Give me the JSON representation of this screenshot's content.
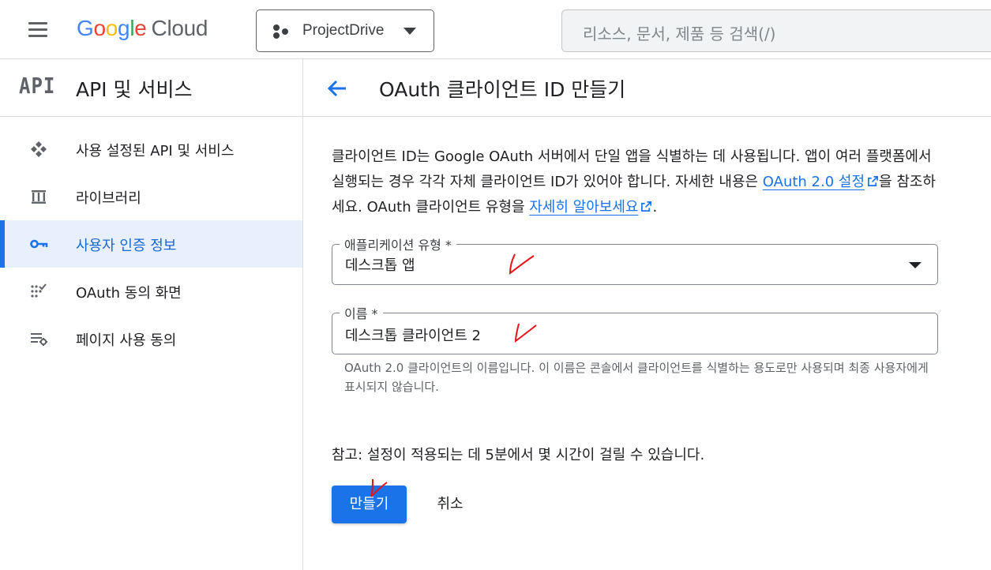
{
  "header": {
    "logo_google": "Google",
    "logo_cloud": "Cloud",
    "project_name": "ProjectDrive",
    "search_placeholder": "리소스, 문서, 제품 등 검색(/)"
  },
  "sidebar": {
    "title": "API 및 서비스",
    "api_icon_text": "API",
    "items": [
      {
        "label": "사용 설정된 API 및 서비스",
        "icon": "api-services-icon"
      },
      {
        "label": "라이브러리",
        "icon": "library-icon"
      },
      {
        "label": "사용자 인증 정보",
        "icon": "key-icon",
        "active": true
      },
      {
        "label": "OAuth 동의 화면",
        "icon": "oauth-consent-icon"
      },
      {
        "label": "페이지 사용 동의",
        "icon": "page-usage-icon"
      }
    ]
  },
  "main": {
    "title": "OAuth 클라이언트 ID 만들기",
    "desc": {
      "part1": "클라이언트 ID는 Google OAuth 서버에서 단일 앱을 식별하는 데 사용됩니다. 앱이 여러 플랫폼에서 실행되는 경우 각각 자체 클라이언트 ID가 있어야 합니다. 자세한 내용은 ",
      "link1": "OAuth 2.0 설정",
      "part2": "을 참조하세요. OAuth 클라이언트 유형을 ",
      "link2": "자세히 알아보세요",
      "part3": "."
    },
    "app_type": {
      "label": "애플리케이션 유형 *",
      "value": "데스크톱 앱"
    },
    "name": {
      "label": "이름 *",
      "value": "데스크톱 클라이언트 2"
    },
    "helper": "OAuth 2.0 클라이언트의 이름입니다. 이 이름은 콘솔에서 클라이언트를 식별하는 용도로만 사용되며 최종 사용자에게 표시되지 않습니다.",
    "note": "참고: 설정이 적용되는 데 5분에서 몇 시간이 걸릴 수 있습니다.",
    "create_label": "만들기",
    "cancel_label": "취소"
  },
  "colors": {
    "accent": "#1a73e8",
    "active_bg": "#e8f0fe",
    "annotation": "#e8131a"
  }
}
